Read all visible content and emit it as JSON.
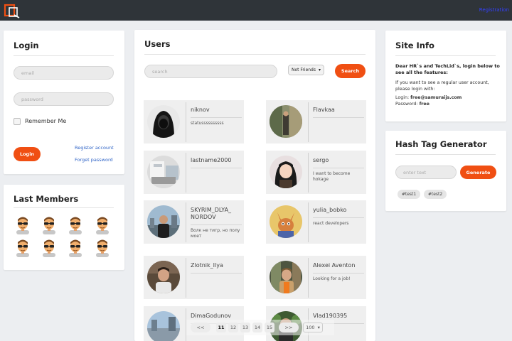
{
  "header": {
    "registration_link": "Registration"
  },
  "login": {
    "title": "Login",
    "email_placeholder": "email",
    "password_placeholder": "password",
    "remember_label": "Remember Me",
    "login_button": "Login",
    "register_link": "Register account",
    "forget_link": "Forget password"
  },
  "last_members": {
    "title": "Last Members",
    "count": 8
  },
  "users": {
    "title": "Users",
    "search_placeholder": "search",
    "filter_selected": "Not Friends",
    "search_button": "Search",
    "items": [
      {
        "name": "niknov",
        "status": "statussssssssss",
        "avatar": "hood"
      },
      {
        "name": "Flavkaa",
        "status": "",
        "avatar": "street"
      },
      {
        "name": "lastname2000",
        "status": "",
        "avatar": "room"
      },
      {
        "name": "sergo",
        "status": "I want to become hokage",
        "avatar": "anime"
      },
      {
        "name": "SKYRIM_DLYA_ NORDOV",
        "status": "Волк не тигр, но полу моет",
        "avatar": "city"
      },
      {
        "name": "yulia_bobko",
        "status": "react developers",
        "avatar": "fox"
      },
      {
        "name": "Zlotnik_Ilya",
        "status": "",
        "avatar": "man"
      },
      {
        "name": "Alexei Aventon",
        "status": "Looking for a job!",
        "avatar": "shop"
      },
      {
        "name": "DimaGodunov",
        "status": "",
        "avatar": "city2"
      },
      {
        "name": "Vlad190395",
        "status": "",
        "avatar": "green"
      }
    ]
  },
  "pagination": {
    "prev": "<<",
    "pages": [
      "11",
      "12",
      "13",
      "14",
      "15"
    ],
    "next": ">>",
    "page_size": "100"
  },
  "site_info": {
    "title": "Site Info",
    "intro": "Dear HR`s and TechLid`s, login below to see all the features:",
    "hint": "If you want to see a regular user account, please login with:",
    "login_label": "Login:",
    "login_value": "free@samuraijs.com",
    "password_label": "Password:",
    "password_value": "free"
  },
  "hashtag": {
    "title": "Hash Tag Generator",
    "input_placeholder": "enter text",
    "generate_button": "Generate",
    "tags": [
      "#test1",
      "#test2"
    ]
  },
  "colors": {
    "accent": "#f04f13",
    "topbar": "#2f3439",
    "link": "#2e63c6"
  }
}
